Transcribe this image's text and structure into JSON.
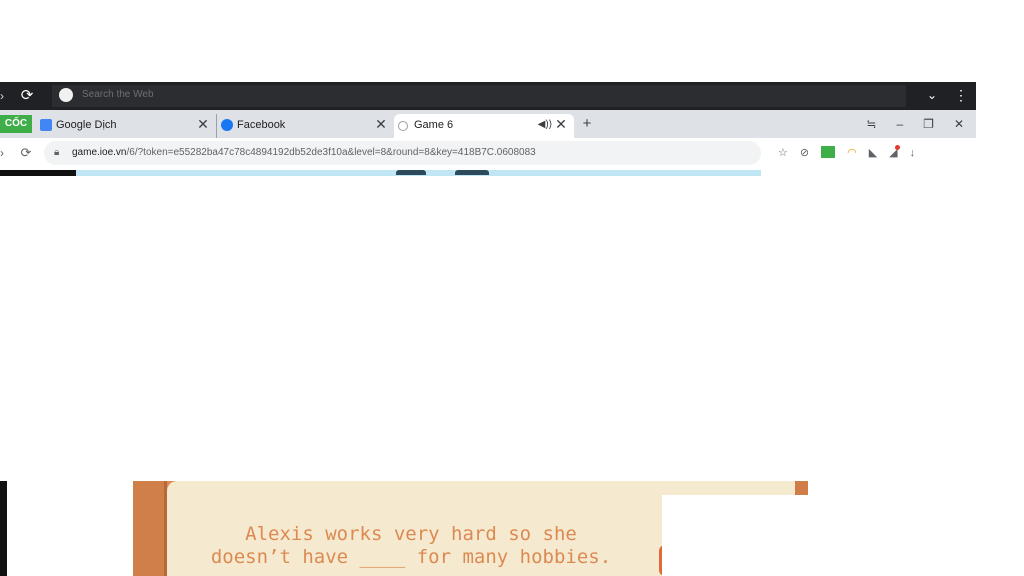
{
  "topbar": {
    "search_placeholder": "Search the Web"
  },
  "tabs": [
    {
      "label": "Google Dịch",
      "icon": "google-translate-icon"
    },
    {
      "label": "Facebook",
      "icon": "facebook-icon"
    },
    {
      "label": "Game 6",
      "icon": "loading-icon",
      "active": true,
      "audio": true
    }
  ],
  "special_tab": {
    "label": "CỐC"
  },
  "address": {
    "host": "game.ioe.vn",
    "path": "/6/?token=e55282ba47c78c4894192db52de3f10a&level=8&round=8&key=418B7C.0608083"
  },
  "question": {
    "line1": "Alexis works very hard so she",
    "line2": "doesn’t have ____ for many hobbies."
  },
  "colors": {
    "chrome_dark": "#202124",
    "tabstrip": "#dee1e6",
    "wood": "#d98b55",
    "paper": "#f5e9cf",
    "question_text": "#dc8a52",
    "green_tab": "#3fae49"
  }
}
